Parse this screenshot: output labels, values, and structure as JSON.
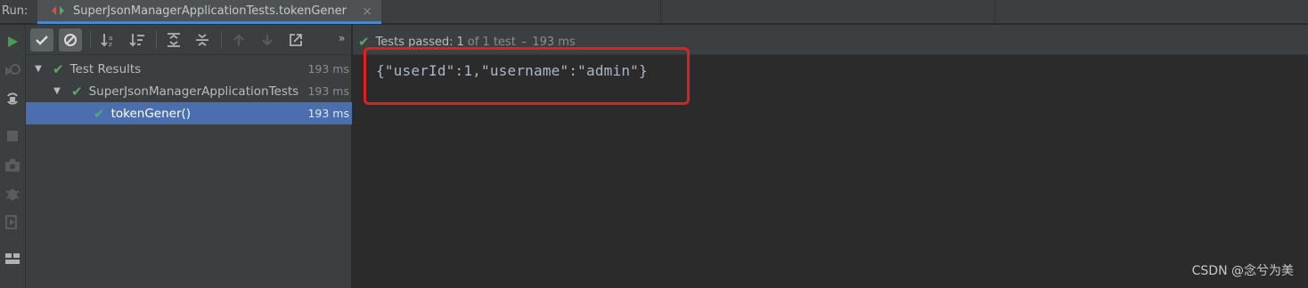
{
  "run_label": "Run:",
  "tab": {
    "title": "SuperJsonManagerApplicationTests.tokenGener",
    "close": "×"
  },
  "left_toolbar": {
    "icons": [
      "rerun-icon",
      "rerun-failed-icon",
      "toggle-auto-test-icon",
      "stop-icon",
      "snapshot-icon",
      "debug-icon",
      "exit-icon",
      "layout-icon"
    ]
  },
  "tree_toolbar": {
    "more": "»",
    "buttons": [
      "show-passed-icon",
      "show-ignored-icon",
      "sort-alpha-icon",
      "sort-duration-icon",
      "expand-all-icon",
      "collapse-all-icon",
      "prev-failed-icon",
      "next-failed-icon",
      "export-icon"
    ]
  },
  "tree": [
    {
      "label": "Test Results",
      "time": "193 ms",
      "expanded": true,
      "status": "passed"
    },
    {
      "label": "SuperJsonManagerApplicationTests",
      "time": "193 ms",
      "expanded": true,
      "status": "passed"
    },
    {
      "label": "tokenGener()",
      "time": "193 ms",
      "selected": true,
      "status": "passed"
    }
  ],
  "status_bar": {
    "passed": "Tests passed:",
    "count": "1",
    "of": "of 1 test",
    "dash": "–",
    "time": "193 ms"
  },
  "console_output": "{\"userId\":1,\"username\":\"admin\"}",
  "watermark": "CSDN @念兮为美",
  "colors": {
    "pass_green": "#59a869",
    "selection_blue": "#4b6eaf",
    "highlight_red": "#e0201f",
    "panel_bg": "#3c3f41",
    "console_bg": "#2b2b2b"
  }
}
